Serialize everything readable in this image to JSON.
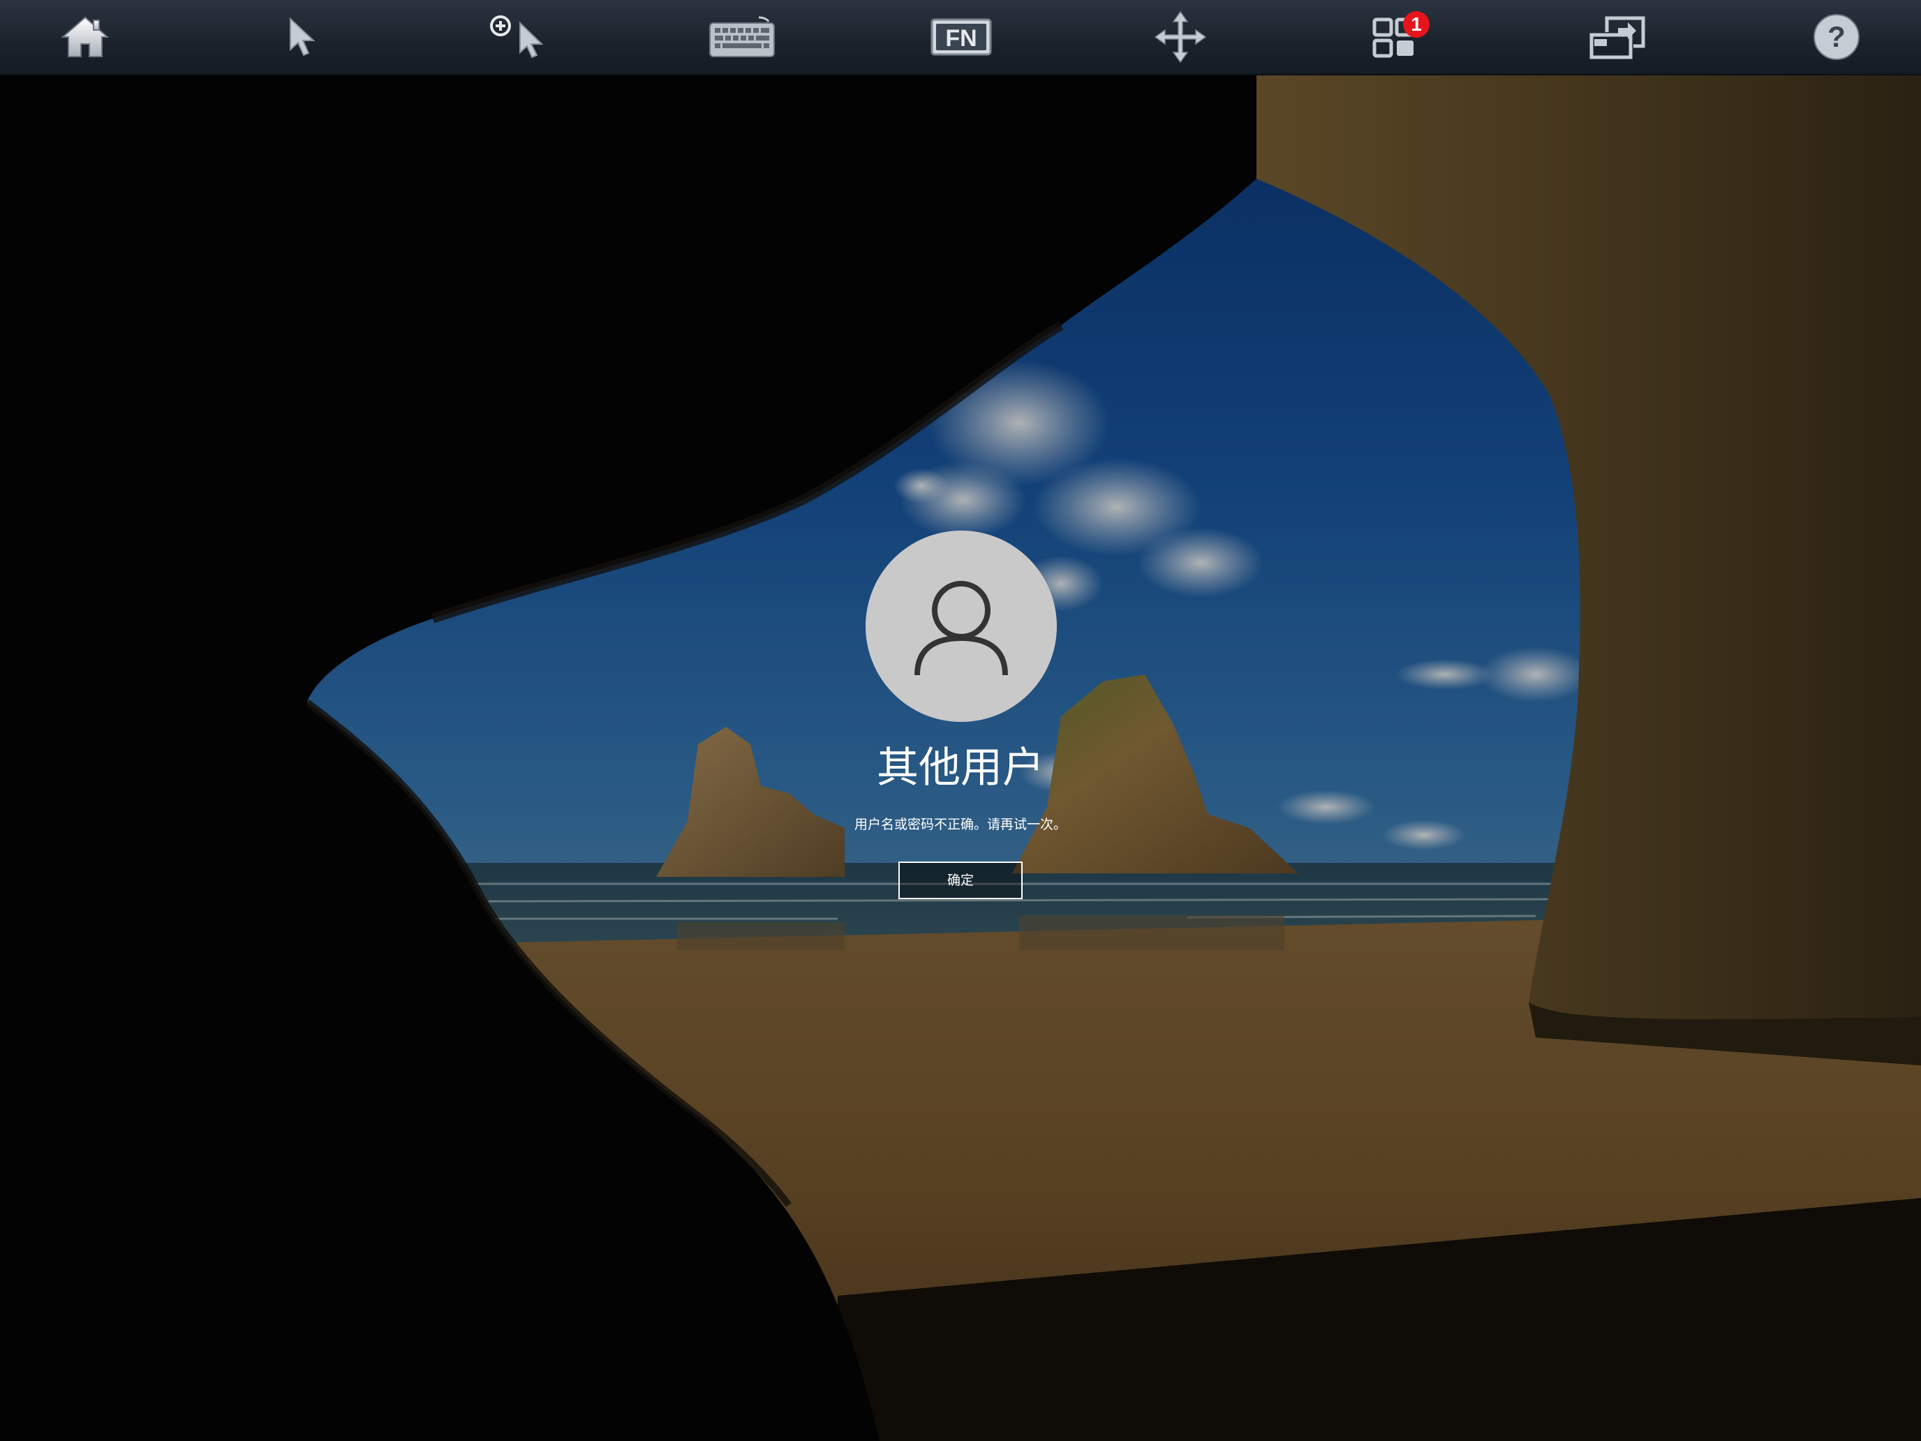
{
  "toolbar": {
    "buttons": [
      {
        "name": "home",
        "icon": "home-icon"
      },
      {
        "name": "pointer",
        "icon": "cursor-icon"
      },
      {
        "name": "touch-pointer",
        "icon": "touch-cursor-icon"
      },
      {
        "name": "keyboard",
        "icon": "keyboard-icon"
      },
      {
        "name": "fn-keys",
        "icon": "fn-icon"
      },
      {
        "name": "pan",
        "icon": "move-arrows-icon"
      },
      {
        "name": "sessions",
        "icon": "grid-windows-icon",
        "badge": "1"
      },
      {
        "name": "resolution",
        "icon": "screen-resize-icon"
      },
      {
        "name": "help",
        "icon": "help-icon"
      }
    ],
    "fn_label": "FN",
    "help_label": "?",
    "badge_color": "#e8141c"
  },
  "login": {
    "avatar_icon": "user-icon",
    "username": "其他用户",
    "message": "用户名或密码不正确。请再试一次。",
    "ok_button": "确定"
  }
}
